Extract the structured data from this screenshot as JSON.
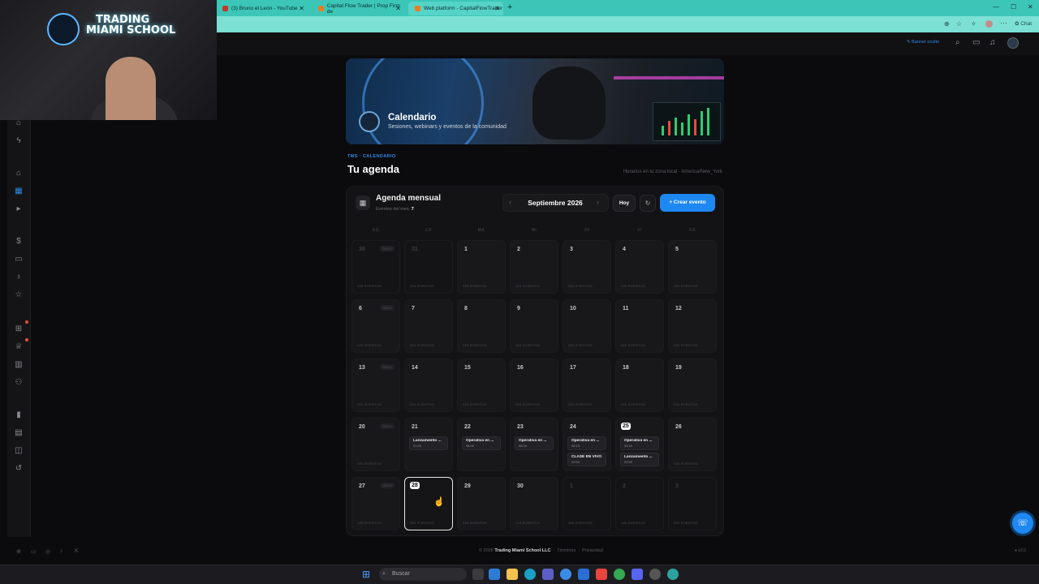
{
  "browser": {
    "tabs": [
      {
        "label": "(3) Bruno el León - YouTube"
      },
      {
        "label": "Capital Flow Trader | Prop Firm de"
      },
      {
        "label": "Web platform - CapitalFlowTrader"
      }
    ],
    "chat_label": "Chat"
  },
  "topnav": {
    "hide_banner": "Banner oculto"
  },
  "webcam": {
    "logo_line1": "TRADING",
    "logo_line2": "MIAMI SCHOOL"
  },
  "banner": {
    "title": "Calendario",
    "subtitle": "Sesiones, webinars y eventos de la comunidad"
  },
  "heading": {
    "breadcrumb": "TMS · CALENDARIO",
    "title": "Tu agenda",
    "timezone_note": "Horarios en tu zona local · America/New_York"
  },
  "calendar": {
    "title": "Agenda mensual",
    "count_label": "Eventos del mes:",
    "count_value": "7",
    "month": "Septiembre 2026",
    "today_button": "Hoy",
    "create_button": "+ Crear evento",
    "weekdays": [
      "DO",
      "LU",
      "MA",
      "MI",
      "JU",
      "VI",
      "SÁ"
    ],
    "empty_label": "SIN EVENTOS",
    "week_labels": [
      "SEM 1",
      "SEM 2",
      "SEM 3",
      "SEM 4",
      "SEM 5"
    ],
    "days": [
      [
        "30",
        "31",
        "1",
        "2",
        "3",
        "4",
        "5"
      ],
      [
        "6",
        "7",
        "8",
        "9",
        "10",
        "11",
        "12"
      ],
      [
        "13",
        "14",
        "15",
        "16",
        "17",
        "18",
        "19"
      ],
      [
        "20",
        "21",
        "22",
        "23",
        "24",
        "25",
        "26"
      ],
      [
        "27",
        "28",
        "29",
        "30",
        "1",
        "2",
        "3"
      ]
    ],
    "events": {
      "e21": {
        "title": "Lanzamiento ...",
        "time": "21:00"
      },
      "e22": {
        "title": "Operativa en ...",
        "time": "08:00"
      },
      "e23": {
        "title": "Operativa en ...",
        "time": "08:00"
      },
      "e24a": {
        "title": "Operativa en ...",
        "time": "08:15"
      },
      "e24b": {
        "title": "CLASE EN VIVO",
        "time": "20:00"
      },
      "e25a": {
        "title": "Operativa en ...",
        "time": "08:15"
      },
      "e25b": {
        "title": "Lanzamiento ...",
        "time": "20:00"
      }
    }
  },
  "footer": {
    "copyright": "© 2026",
    "company": "Trading Miami School LLC",
    "terms": "Términos",
    "privacy": "Privacidad",
    "version": "v3.0"
  },
  "taskbar": {
    "search_placeholder": "Buscar"
  },
  "colors": {
    "accent": "#1e88f2",
    "browser_tab": "#3cc6b8",
    "background": "#0b0b0d"
  }
}
